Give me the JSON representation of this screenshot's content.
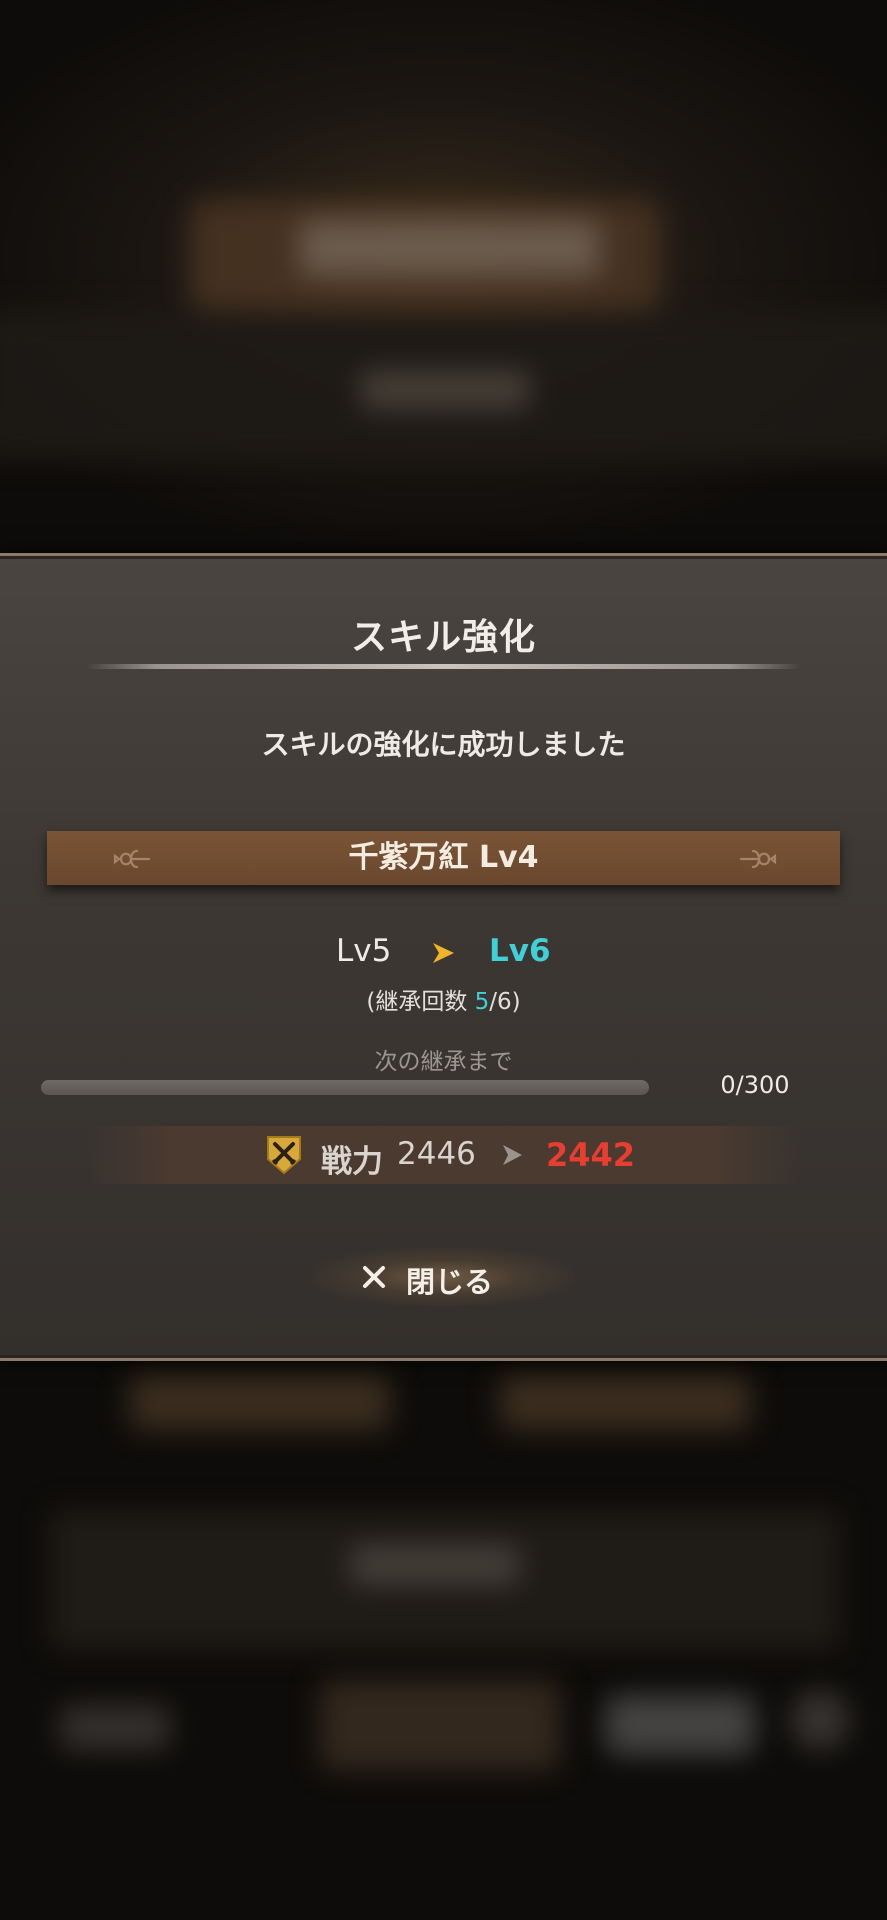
{
  "dialog": {
    "title": "スキル強化",
    "message": "スキルの強化に成功しました",
    "skill_name": "千紫万紅 Lv4",
    "level_from": "Lv5",
    "level_to": "Lv6",
    "inherit": {
      "prefix": "(継承回数 ",
      "current": "5",
      "suffix": "/6)"
    },
    "next_inherit_label": "次の継承まで",
    "progress": {
      "text": "0/300",
      "fraction": 0.0
    },
    "power": {
      "label": "戦力",
      "from": "2446",
      "to": "2442"
    },
    "close_label": "閉じる"
  },
  "colors": {
    "accent_cyan": "#3fd0d8",
    "arrow_gold": "#f0b42a",
    "power_down_red": "#e83d2f",
    "banner_brown": "#7a5436"
  },
  "icons": {
    "level_arrow": "chevron-right-icon",
    "power": "crossed-swords-shield-icon",
    "power_arrow": "chevron-right-icon",
    "close": "close-icon",
    "banner_ornaments": "scroll-ornament-icon"
  }
}
